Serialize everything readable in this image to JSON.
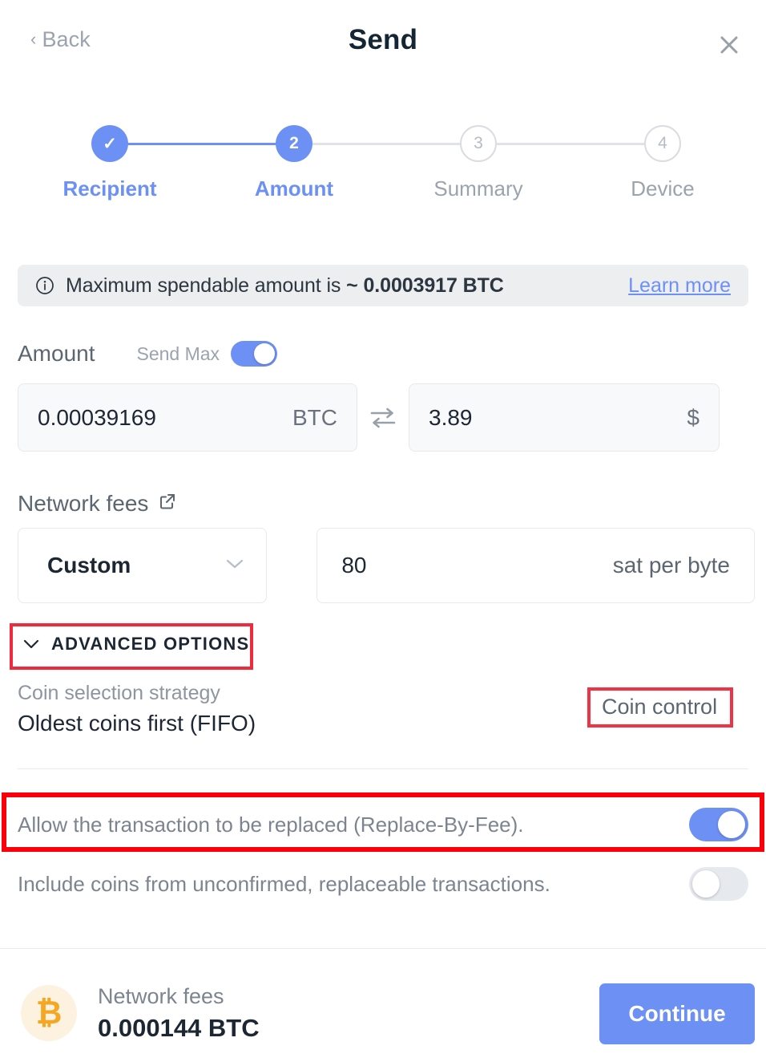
{
  "header": {
    "back_label": "Back",
    "title": "Send",
    "close_icon": "close-icon"
  },
  "stepper": {
    "steps": [
      {
        "number": "1",
        "marker": "✓",
        "label": "Recipient",
        "state": "done"
      },
      {
        "number": "2",
        "marker": "2",
        "label": "Amount",
        "state": "active"
      },
      {
        "number": "3",
        "marker": "3",
        "label": "Summary",
        "state": "todo"
      },
      {
        "number": "4",
        "marker": "4",
        "label": "Device",
        "state": "todo"
      }
    ]
  },
  "banner": {
    "icon": "info-icon",
    "text_prefix": "Maximum spendable amount is ",
    "amount": "~ 0.0003917 BTC",
    "learn_more": "Learn more"
  },
  "amount": {
    "label": "Amount",
    "send_max_label": "Send Max",
    "send_max_on": true,
    "crypto_value": "0.00039169",
    "crypto_unit": "BTC",
    "swap_icon": "swap-icon",
    "fiat_value": "3.89",
    "fiat_unit": "$"
  },
  "network_fees": {
    "label": "Network fees",
    "external_link_icon": "external-link-icon",
    "strategy_selected": "Custom",
    "chevron_icon": "chevron-down-icon",
    "rate_value": "80",
    "rate_unit": "sat per byte"
  },
  "advanced": {
    "toggle_icon": "chevron-down-icon",
    "title": "ADVANCED OPTIONS",
    "coin_strategy_label": "Coin selection strategy",
    "coin_strategy_value": "Oldest coins first (FIFO)",
    "coin_control_label": "Coin control"
  },
  "options": [
    {
      "text": "Allow the transaction to be replaced (Replace-By-Fee).",
      "enabled": true
    },
    {
      "text": "Include coins from unconfirmed, replaceable transactions.",
      "enabled": false
    }
  ],
  "footer": {
    "btc_icon": "bitcoin-icon",
    "fee_label": "Network fees",
    "fee_value": "0.000144 BTC",
    "continue_label": "Continue"
  },
  "colors": {
    "accent_blue": "#6d90f4",
    "annotation_red": "#ef2a3c",
    "bitcoin_orange": "#f5a623",
    "muted_text": "#8d96a0"
  }
}
